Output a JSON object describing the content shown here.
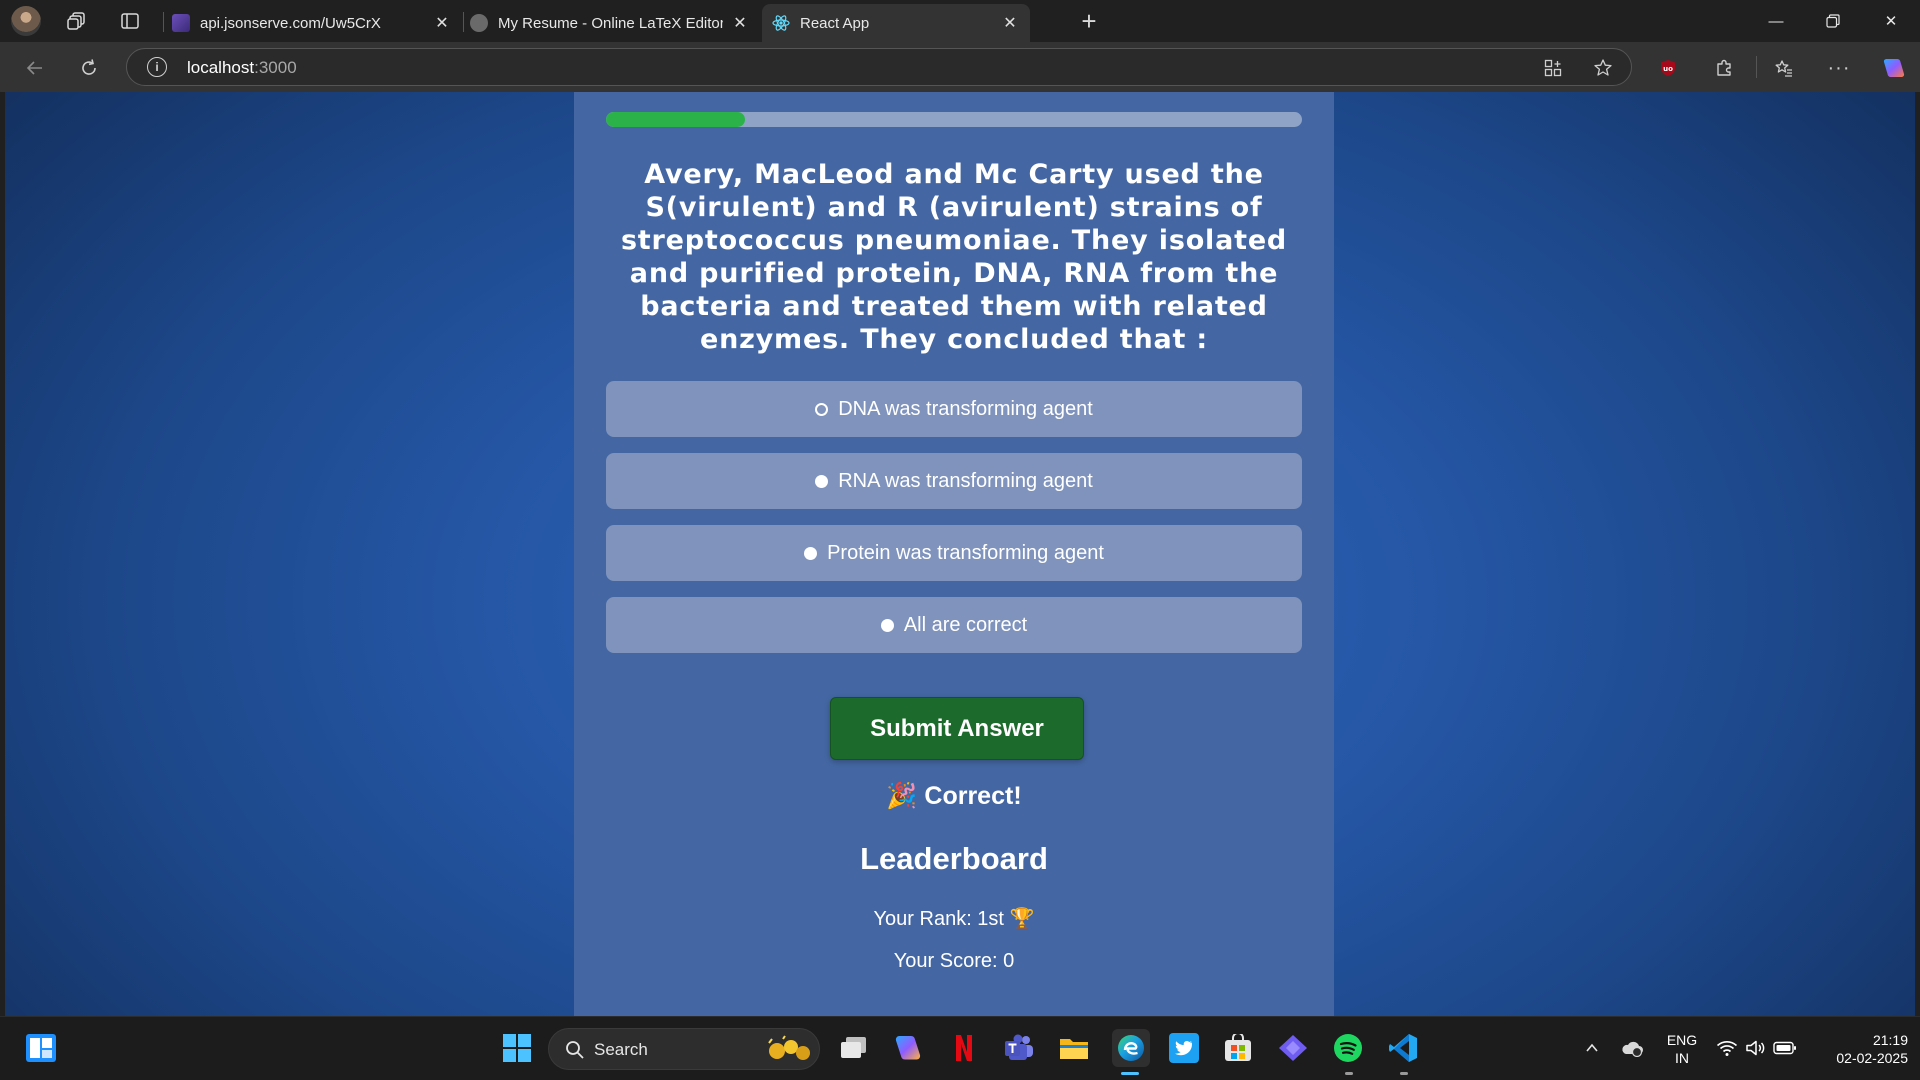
{
  "browser": {
    "tabs": [
      {
        "title": "api.jsonserve.com/Uw5CrX",
        "active": false
      },
      {
        "title": "My Resume - Online LaTeX Editor",
        "active": false
      },
      {
        "title": "React App",
        "active": true
      }
    ],
    "address": {
      "host": "localhost",
      "port": ":3000"
    }
  },
  "quiz": {
    "progress_fraction": 0.2,
    "question": "Avery, MacLeod and Mc Carty used the S(virulent) and R (avirulent) strains of streptococcus pneumoniae. They isolated and purified protein, DNA, RNA from the bacteria and treated them with related enzymes. They concluded that :",
    "options": [
      {
        "label": "DNA was transforming agent",
        "selected": true
      },
      {
        "label": "RNA was transforming agent",
        "selected": false
      },
      {
        "label": "Protein was transforming agent",
        "selected": false
      },
      {
        "label": "All are correct",
        "selected": false
      }
    ],
    "submit_label": "Submit Answer",
    "feedback": "🎉 Correct!",
    "leaderboard_title": "Leaderboard",
    "rank_text": "Your Rank: 1st 🏆",
    "score_text": "Your Score: 0"
  },
  "taskbar": {
    "search_label": "Search",
    "language": {
      "line1": "ENG",
      "line2": "IN"
    },
    "time": "21:19",
    "date": "02-02-2025"
  },
  "colors": {
    "card": "#4467a3",
    "option": "#7f93bc",
    "progress_fill": "#2bb34a",
    "submit": "#1d6b2c"
  }
}
